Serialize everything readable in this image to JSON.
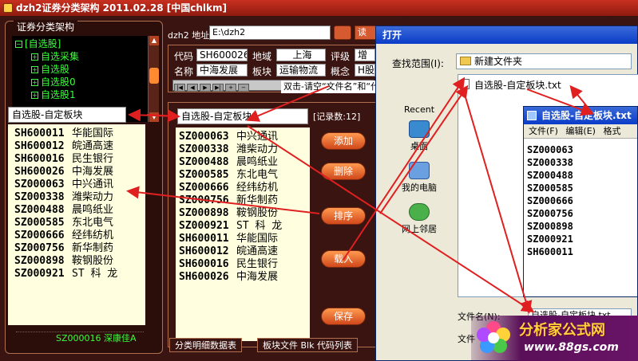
{
  "app": {
    "title": "dzh2证券分类架构 2011.02.28 [中国chlkm]"
  },
  "left_panel": {
    "title": "证券分类架构",
    "tree": [
      {
        "label": "[自选股]",
        "level": 0
      },
      {
        "label": "自选采集",
        "level": 1
      },
      {
        "label": "自选股",
        "level": 1
      },
      {
        "label": "自选股0",
        "level": 1
      },
      {
        "label": "自选股1",
        "level": 1
      }
    ],
    "selected_name": "自选股-自定板块",
    "stocks": [
      {
        "code": "SH600011",
        "name": "华能国际"
      },
      {
        "code": "SH600012",
        "name": "皖通高速"
      },
      {
        "code": "SH600016",
        "name": "民生银行"
      },
      {
        "code": "SH600026",
        "name": "中海发展"
      },
      {
        "code": "SZ000063",
        "name": "中兴通讯"
      },
      {
        "code": "SZ000338",
        "name": "潍柴动力"
      },
      {
        "code": "SZ000488",
        "name": "晨鸣纸业"
      },
      {
        "code": "SZ000585",
        "name": "东北电气"
      },
      {
        "code": "SZ000666",
        "name": "经纬纺机"
      },
      {
        "code": "SZ000756",
        "name": "新华制药"
      },
      {
        "code": "SZ000898",
        "name": "鞍钢股份"
      },
      {
        "code": "SZ000921",
        "name": "ST 科 龙"
      }
    ],
    "status": "SZ000016 深康佳A"
  },
  "address": {
    "label": "dzh2 地址",
    "value": "E:\\dzh2",
    "read_label": "读"
  },
  "info": {
    "code_label": "代码",
    "code_value": "SH600026",
    "region_label": "地域",
    "region_value": "上海",
    "rating_label": "评级",
    "rating_value": "增",
    "name_label": "名称",
    "name_value": "中海发展",
    "sector_label": "板块",
    "sector_value": "运输物流",
    "concept_label": "概念",
    "concept_value": "H股"
  },
  "callout": "双击-请空“文件名”和“代码列表”",
  "center": {
    "name_value": "自选股-自定板块",
    "record_count": "[记录数:12]",
    "stocks": [
      {
        "code": "SZ000063",
        "name": "中兴通讯"
      },
      {
        "code": "SZ000338",
        "name": "潍柴动力"
      },
      {
        "code": "SZ000488",
        "name": "晨鸣纸业"
      },
      {
        "code": "SZ000585",
        "name": "东北电气"
      },
      {
        "code": "SZ000666",
        "name": "经纬纺机"
      },
      {
        "code": "SZ000756",
        "name": "新华制药"
      },
      {
        "code": "SZ000898",
        "name": "鞍钢股份"
      },
      {
        "code": "SZ000921",
        "name": "ST 科 龙"
      },
      {
        "code": "SH600011",
        "name": "华能国际"
      },
      {
        "code": "SH600012",
        "name": "皖通高速"
      },
      {
        "code": "SH600016",
        "name": "民生银行"
      },
      {
        "code": "SH600026",
        "name": "中海发展"
      }
    ],
    "buttons": {
      "add": "添加",
      "delete": "删除",
      "sort": "排序",
      "load": "载入",
      "save": "保存"
    },
    "tabs": [
      "分类明细数据表",
      "板块文件 Blk 代码列表"
    ]
  },
  "open_dialog": {
    "title": "打开",
    "look_in_label": "查找范围(I):",
    "look_in_value": "新建文件夹",
    "sidebar": [
      "Recent",
      "桌面",
      "我的电脑",
      "网上邻居"
    ],
    "file": "自选股-自定板块.txt",
    "filename_label": "文件名(N):",
    "filename_value": "自选股-自定板块.txt",
    "filetype_label": "文件"
  },
  "notepad": {
    "title": "自选股-自定板块.txt",
    "menu": [
      "文件(F)",
      "编辑(E)",
      "格式"
    ],
    "lines": [
      "SZ000063",
      "SZ000338",
      "SZ000488",
      "SZ000585",
      "SZ000666",
      "SZ000756",
      "SZ000898",
      "SZ000921",
      "SH600011"
    ]
  },
  "logo": {
    "title": "分析家公式网",
    "url": "www.88gs.com"
  },
  "colors": {
    "panel_bg": "#3a1410",
    "list_bg": "#ffffe0",
    "tree_text": "#3aff3a",
    "arrow": "#e02020",
    "button": "#d0481a"
  }
}
